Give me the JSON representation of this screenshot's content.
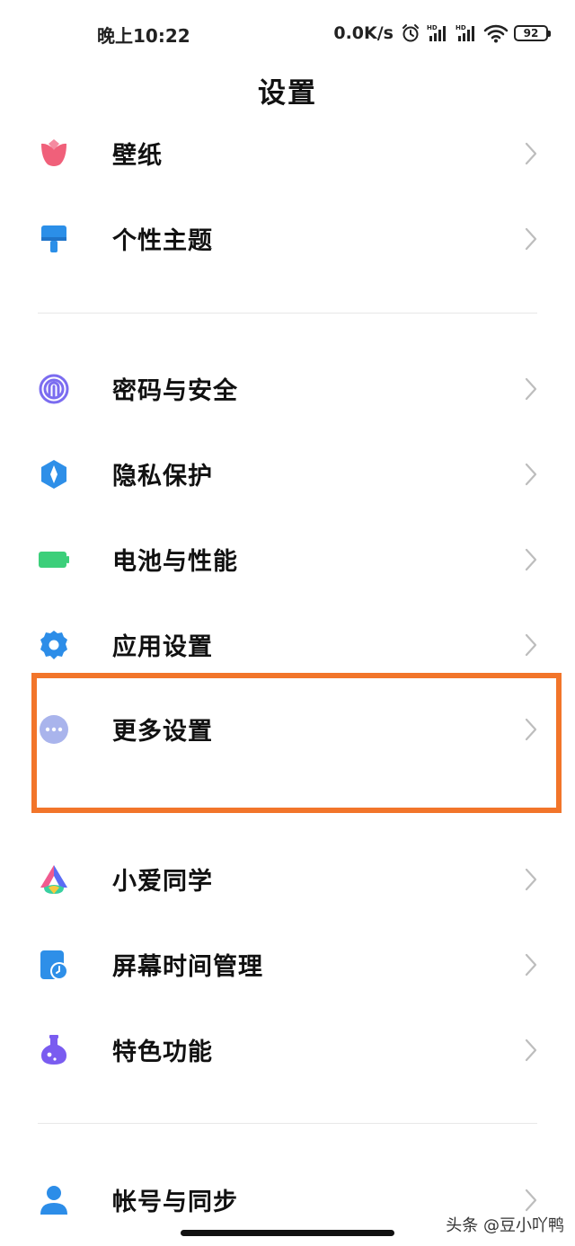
{
  "status_bar": {
    "time": "晚上10:22",
    "net_speed": "0.0K/s",
    "battery_level": "92",
    "icons": [
      "alarm-icon",
      "hd-signal-icon",
      "hd-signal-icon",
      "wifi-icon",
      "battery-icon"
    ]
  },
  "page": {
    "title": "设置"
  },
  "settings": {
    "wallpaper": {
      "label": "壁纸",
      "icon": "tulip-icon",
      "color": "#f0607a"
    },
    "themes": {
      "label": "个性主题",
      "icon": "brush-icon",
      "color": "#2b8fe8"
    },
    "password_security": {
      "label": "密码与安全",
      "icon": "fingerprint-icon",
      "color": "#7b6cf0"
    },
    "privacy": {
      "label": "隐私保护",
      "icon": "privacy-shield-icon",
      "color": "#2e8fe8"
    },
    "battery_performance": {
      "label": "电池与性能",
      "icon": "battery-icon",
      "color": "#3ccf7a"
    },
    "app_settings": {
      "label": "应用设置",
      "icon": "gear-icon",
      "color": "#2c8de8"
    },
    "more_settings": {
      "label": "更多设置",
      "icon": "more-dots-icon",
      "color": "#a9b4ec",
      "highlighted": true
    },
    "xiaoai": {
      "label": "小爱同学",
      "icon": "xiaoai-icon",
      "color": "#5b6cf5"
    },
    "screen_time": {
      "label": "屏幕时间管理",
      "icon": "screen-time-icon",
      "color": "#2e8fe8"
    },
    "special_features": {
      "label": "特色功能",
      "icon": "flask-icon",
      "color": "#7a5cf0"
    },
    "account_sync": {
      "label": "帐号与同步",
      "icon": "person-icon",
      "color": "#2c8de8"
    }
  },
  "highlight": {
    "color": "#f2752a"
  },
  "watermark": "头条 @豆小吖鸭"
}
